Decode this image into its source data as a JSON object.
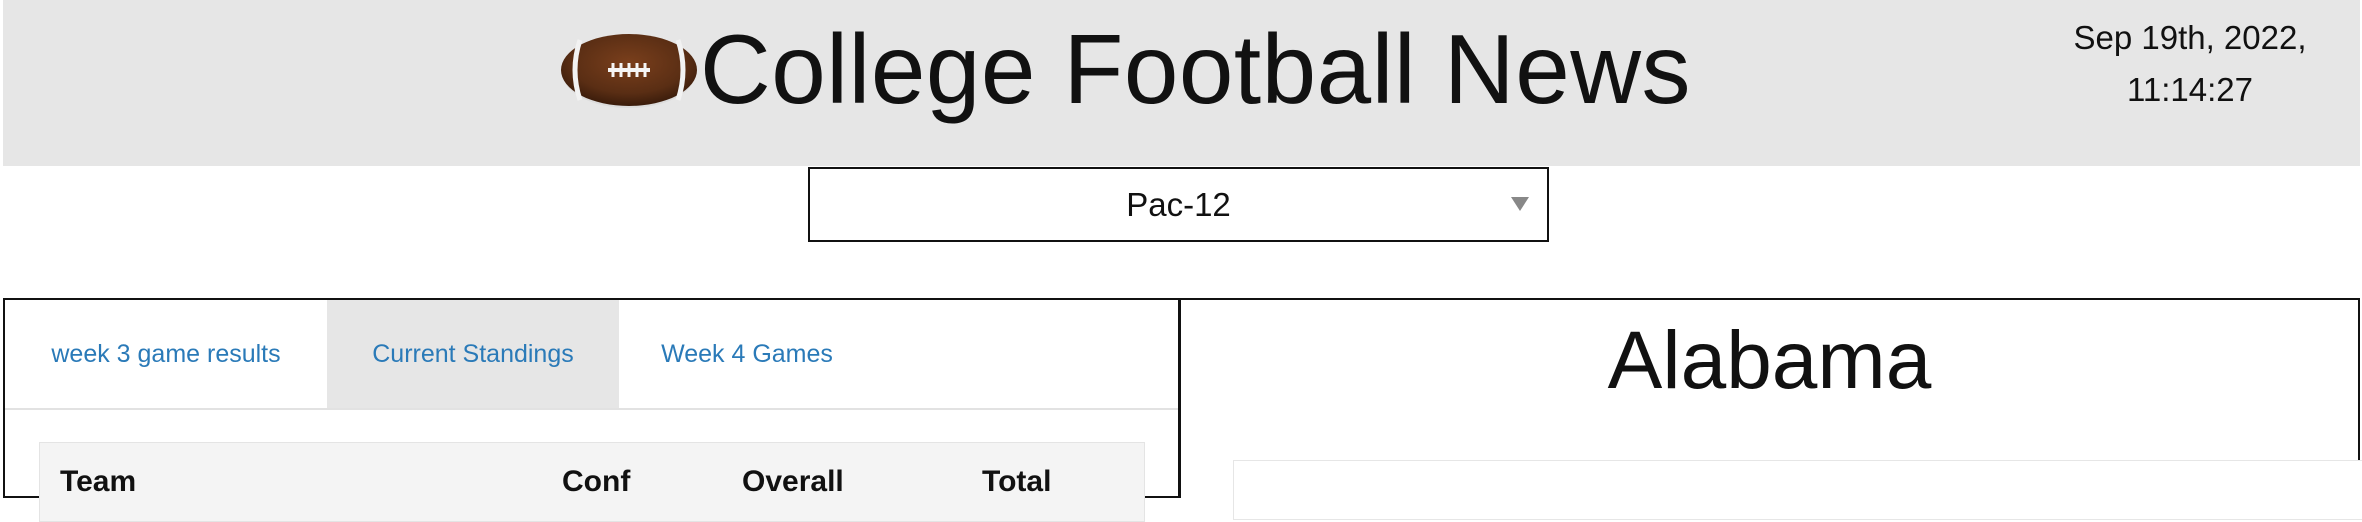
{
  "header": {
    "title": "College Football News",
    "logo_icon": "football-icon",
    "date": "Sep 19th, 2022,",
    "time": "11:14:27"
  },
  "conference_select": {
    "selected": "Pac-12"
  },
  "tabs": [
    {
      "label": "week 3 game results",
      "active": false
    },
    {
      "label": "Current Standings",
      "active": true
    },
    {
      "label": "Week 4 Games",
      "active": false
    }
  ],
  "standings": {
    "columns": [
      "Team",
      "Conf",
      "Overall",
      "Total"
    ]
  },
  "team_panel": {
    "name": "Alabama"
  },
  "colors": {
    "header_bg": "#e6e6e6",
    "link": "#2a7ab8",
    "football_brown": "#5a2e14"
  }
}
